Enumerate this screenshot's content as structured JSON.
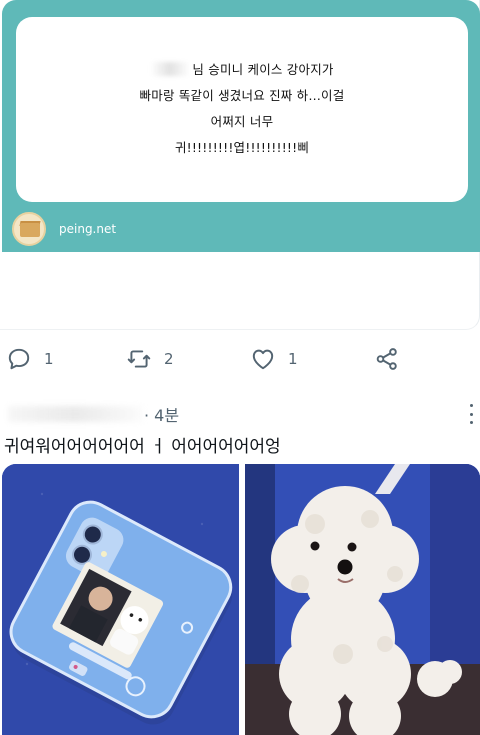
{
  "peing_card": {
    "question_lines": [
      "님 승미니 케이스 강아지가",
      "빠마랑 똑같이 생겼너요 진짜 하…이걸",
      "어쩌지 너무",
      "귀!!!!!!!!!엽!!!!!!!!!!삐"
    ],
    "site": "peing.net",
    "colors": {
      "frame": "#5fb9b8"
    }
  },
  "actions": {
    "reply": {
      "icon": "reply-icon",
      "count": "1"
    },
    "retweet": {
      "icon": "retweet-icon",
      "count": "2"
    },
    "like": {
      "icon": "heart-icon",
      "count": "1"
    },
    "share": {
      "icon": "share-icon"
    }
  },
  "tweet2": {
    "time": "· 4분",
    "text": "귀여워어어어어어어 ㅓ 어어어어어어엉",
    "media": [
      {
        "icon": "photo-phone-case"
      },
      {
        "icon": "photo-white-poodle"
      }
    ]
  },
  "colors": {
    "text": "#0f1419",
    "muted": "#536471"
  }
}
